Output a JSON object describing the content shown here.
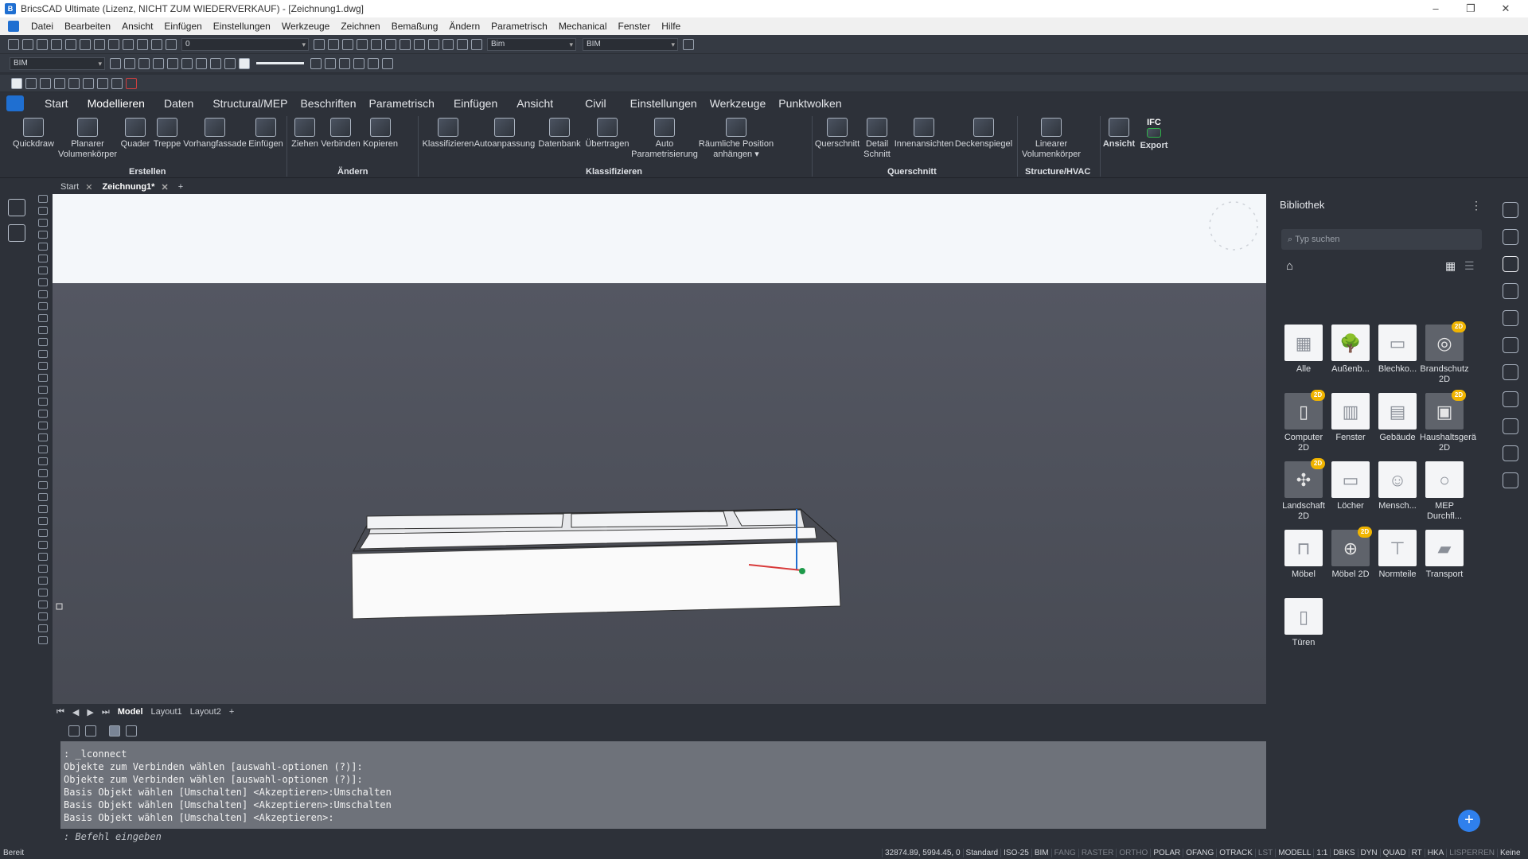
{
  "window": {
    "title": "BricsCAD Ultimate (Lizenz, NICHT ZUM WIEDERVERKAUF) - [Zeichnung1.dwg]",
    "min": "–",
    "max": "❐",
    "close": "✕"
  },
  "menu": [
    "Datei",
    "Bearbeiten",
    "Ansicht",
    "Einfügen",
    "Einstellungen",
    "Werkzeuge",
    "Zeichnen",
    "Bemaßung",
    "Ändern",
    "Parametrisch",
    "Mechanical",
    "Fenster",
    "Hilfe"
  ],
  "toolbar1": {
    "layer": "0",
    "combo1": "Bim",
    "combo2": "BIM"
  },
  "toolbar2": {
    "workspace": "BIM"
  },
  "ribbon_tabs": [
    "Start",
    "Modellieren",
    "Daten",
    "Structural/MEP",
    "Beschriften",
    "Parametrisch",
    "Einfügen",
    "Ansicht",
    "Civil",
    "Einstellungen",
    "Werkzeuge",
    "Punktwolken"
  ],
  "ribbon_buttons": [
    {
      "l1": "Quickdraw",
      "l2": ""
    },
    {
      "l1": "Planarer",
      "l2": "Volumenkörper"
    },
    {
      "l1": "Quader",
      "l2": ""
    },
    {
      "l1": "Treppe",
      "l2": ""
    },
    {
      "l1": "Vorhangfassade",
      "l2": ""
    },
    {
      "l1": "Einfügen",
      "l2": ""
    },
    {
      "l1": "Ziehen",
      "l2": ""
    },
    {
      "l1": "Verbinden",
      "l2": ""
    },
    {
      "l1": "Kopieren",
      "l2": ""
    },
    {
      "l1": "Klassifizieren",
      "l2": ""
    },
    {
      "l1": "Autoanpassung",
      "l2": ""
    },
    {
      "l1": "Datenbank",
      "l2": ""
    },
    {
      "l1": "Übertragen",
      "l2": ""
    },
    {
      "l1": "Auto",
      "l2": "Parametrisierung"
    },
    {
      "l1": "Räumliche Position",
      "l2": "anhängen ▾"
    },
    {
      "l1": "Querschnitt",
      "l2": ""
    },
    {
      "l1": "Detail",
      "l2": "Schnitt"
    },
    {
      "l1": "Innenansichten",
      "l2": ""
    },
    {
      "l1": "Deckenspiegel",
      "l2": ""
    },
    {
      "l1": "Linearer",
      "l2": "Volumenkörper"
    },
    {
      "l1": "Ansicht",
      "l2": ""
    },
    {
      "l1": "Export",
      "l2": ""
    }
  ],
  "ribbon_groups": [
    "Erstellen",
    "Ändern",
    "Klassifizieren",
    "Querschnitt",
    "Structure/HVAC"
  ],
  "ifc_label": "IFC",
  "doc_tabs": [
    {
      "label": "Start"
    },
    {
      "label": "Zeichnung1*"
    }
  ],
  "layout_tabs": [
    "Model",
    "Layout1",
    "Layout2"
  ],
  "command_lines": [
    ": _lconnect",
    "Objekte zum Verbinden wählen [auswahl-optionen (?)]:",
    "Objekte zum Verbinden wählen [auswahl-optionen (?)]:",
    "Basis Objekt wählen [Umschalten] <Akzeptieren>:Umschalten",
    "Basis Objekt wählen [Umschalten] <Akzeptieren>:Umschalten",
    "Basis Objekt wählen [Umschalten] <Akzeptieren>:"
  ],
  "command_prompt": ": Befehl eingeben",
  "library": {
    "title": "Bibliothek",
    "search_placeholder": "Typ suchen",
    "items": [
      {
        "l1": "Alle",
        "l2": "",
        "badge": "",
        "icon": "▦"
      },
      {
        "l1": "Außenb...",
        "l2": "",
        "badge": "",
        "icon": "🌳"
      },
      {
        "l1": "Blechko...",
        "l2": "",
        "badge": "",
        "icon": "▭"
      },
      {
        "l1": "Brandschutz",
        "l2": "2D",
        "badge": "2D",
        "icon": "◎"
      },
      {
        "l1": "Computer",
        "l2": "2D",
        "badge": "2D",
        "icon": "▯"
      },
      {
        "l1": "Fenster",
        "l2": "",
        "badge": "",
        "icon": "▥"
      },
      {
        "l1": "Gebäude",
        "l2": "",
        "badge": "",
        "icon": "▤"
      },
      {
        "l1": "Haushaltsgerä",
        "l2": "2D",
        "badge": "2D",
        "icon": "▣"
      },
      {
        "l1": "Landschaft",
        "l2": "2D",
        "badge": "2D",
        "icon": "✣"
      },
      {
        "l1": "Löcher",
        "l2": "",
        "badge": "",
        "icon": "▭"
      },
      {
        "l1": "Mensch...",
        "l2": "",
        "badge": "",
        "icon": "☺"
      },
      {
        "l1": "MEP",
        "l2": "Durchfl...",
        "badge": "",
        "icon": "○"
      },
      {
        "l1": "Möbel",
        "l2": "",
        "badge": "",
        "icon": "⊓"
      },
      {
        "l1": "Möbel 2D",
        "l2": "",
        "badge": "2D",
        "icon": "⊕"
      },
      {
        "l1": "Normteile",
        "l2": "",
        "badge": "",
        "icon": "⊤"
      },
      {
        "l1": "Transport",
        "l2": "",
        "badge": "",
        "icon": "▰"
      },
      {
        "l1": "Türen",
        "l2": "",
        "badge": "",
        "icon": "▯"
      }
    ]
  },
  "status": {
    "left": "Bereit",
    "coords": "32874.89, 5994.45, 0",
    "items": [
      "Standard",
      "ISO-25",
      "BIM",
      "FANG",
      "RASTER",
      "ORTHO",
      "POLAR",
      "OFANG",
      "OTRACK",
      "LST",
      "MODELL",
      "1:1",
      "DBKS",
      "DYN",
      "QUAD",
      "RT",
      "HKA",
      "LISPERREN",
      "Keine"
    ],
    "off": [
      "FANG",
      "RASTER",
      "ORTHO",
      "LST",
      "LISPERREN"
    ]
  },
  "colors": {
    "accent": "#1f6fd1",
    "badge": "#f0b400",
    "panel": "#2d3139"
  }
}
